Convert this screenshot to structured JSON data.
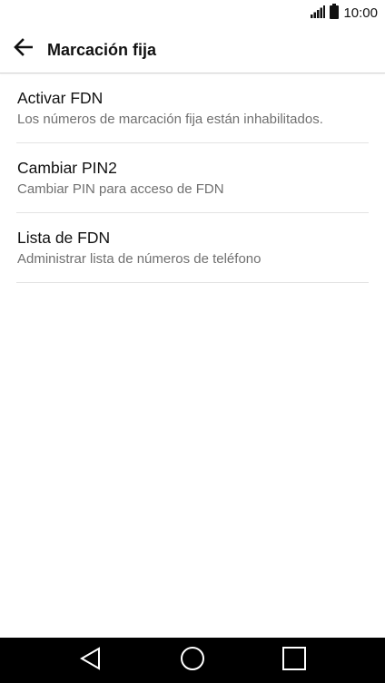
{
  "status_bar": {
    "time": "10:00",
    "signal_icon": "signal-icon",
    "battery_icon": "battery-icon"
  },
  "app_bar": {
    "title": "Marcación fija",
    "back_icon": "back-arrow-icon"
  },
  "items": [
    {
      "title": "Activar FDN",
      "subtitle": "Los números de marcación fija están inhabilitados."
    },
    {
      "title": "Cambiar PIN2",
      "subtitle": "Cambiar PIN para acceso de FDN"
    },
    {
      "title": "Lista de FDN",
      "subtitle": "Administrar lista de números de teléfono"
    }
  ],
  "nav_bar": {
    "back_icon": "nav-back-icon",
    "home_icon": "nav-home-icon",
    "recents_icon": "nav-recents-icon"
  },
  "colors": {
    "background": "#ffffff",
    "text_primary": "#111111",
    "text_secondary": "#707070",
    "divider": "#e3e3e3",
    "nav_bar": "#000000"
  }
}
